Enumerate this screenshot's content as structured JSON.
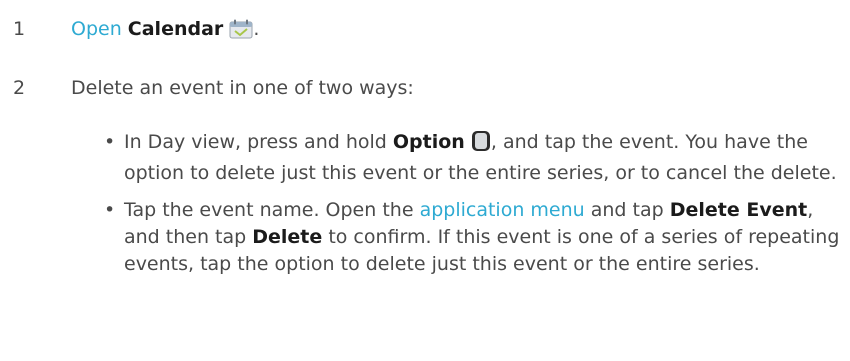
{
  "steps": [
    {
      "number": "1",
      "parts": {
        "link": "Open",
        "space": " ",
        "app_name": "Calendar",
        "end": "."
      },
      "icon": "calendar-icon"
    },
    {
      "number": "2",
      "text": "Delete an event in one of two ways:"
    }
  ],
  "bullets": [
    {
      "dot": "•",
      "t1": "In Day view, press and hold ",
      "b1": "Option",
      "t2": ", and tap the event. You have the option to delete just this event or the entire series, or to cancel the delete.",
      "icon": "option-key-icon"
    },
    {
      "dot": "•",
      "t1": "Tap the event name. Open the ",
      "link": "application menu",
      "t2": " and tap ",
      "b1": "Delete Event",
      "t3": ", and then tap ",
      "b2": "Delete",
      "t4": " to confirm. If this event is one of a series of repeating events, tap the option to delete just this event or the entire series."
    }
  ],
  "colors": {
    "link": "#2eaad2",
    "text": "#4a4a4a",
    "bold": "#1b1b1b"
  }
}
